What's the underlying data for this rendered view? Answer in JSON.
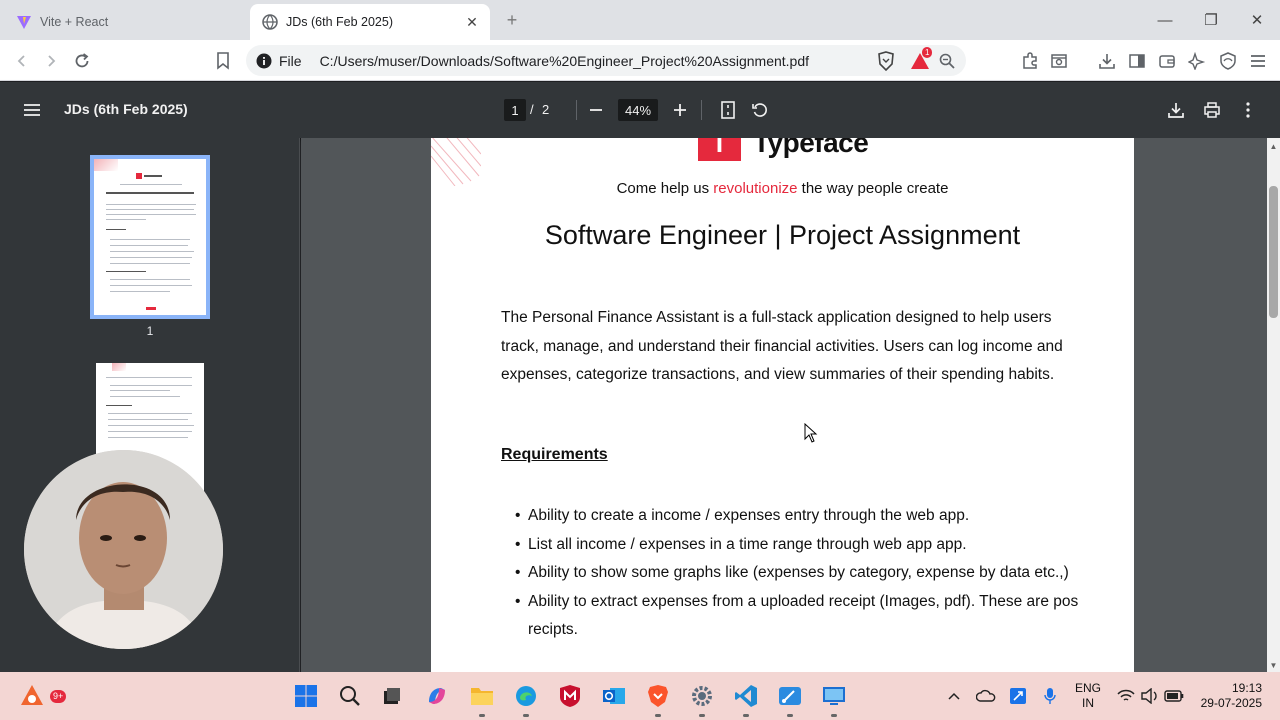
{
  "browser": {
    "tabs": [
      {
        "title": "Vite + React",
        "active": false
      },
      {
        "title": "JDs (6th Feb 2025)",
        "active": true
      }
    ],
    "address": {
      "scheme_label": "File",
      "url": "C:/Users/muser/Downloads/Software%20Engineer_Project%20Assignment.pdf"
    },
    "notification_badge": "1"
  },
  "pdf_viewer": {
    "title": "JDs (6th Feb 2025)",
    "current_page": "1",
    "page_separator": "/",
    "total_pages": "2",
    "zoom": "44%",
    "thumbnails": [
      {
        "label": "1",
        "selected": true
      },
      {
        "label": "",
        "selected": false
      }
    ]
  },
  "document": {
    "brand": "Typeface",
    "tagline_before": "Come help us ",
    "tagline_accent": "revolutionize",
    "tagline_after": " the way people create",
    "heading": "Software Engineer | Project Assignment",
    "intro": "The Personal Finance Assistant is a full-stack application designed to help users track, manage, and understand their financial activities. Users can log income and expenses, categorize transactions, and view summaries of their spending habits.",
    "requirements_heading": "Requirements ",
    "requirements": [
      "Ability to create a income / expenses entry through the web app.",
      "List all income / expenses in a time range through web app app.",
      "Ability to show some graphs like (expenses by category, expense by data etc.,)",
      "Ability to extract expenses from a uploaded receipt (Images, pdf). These are pos recipts."
    ]
  },
  "taskbar": {
    "notification_count": "9+",
    "language_line1": "ENG",
    "language_line2": "IN",
    "time": "19:13",
    "date": "29-07-2025"
  },
  "colors": {
    "brand_red": "#e5293d",
    "viewer_bg": "#525659",
    "toolbar_bg": "#323639",
    "thumb_selected": "#8ab4f8"
  }
}
